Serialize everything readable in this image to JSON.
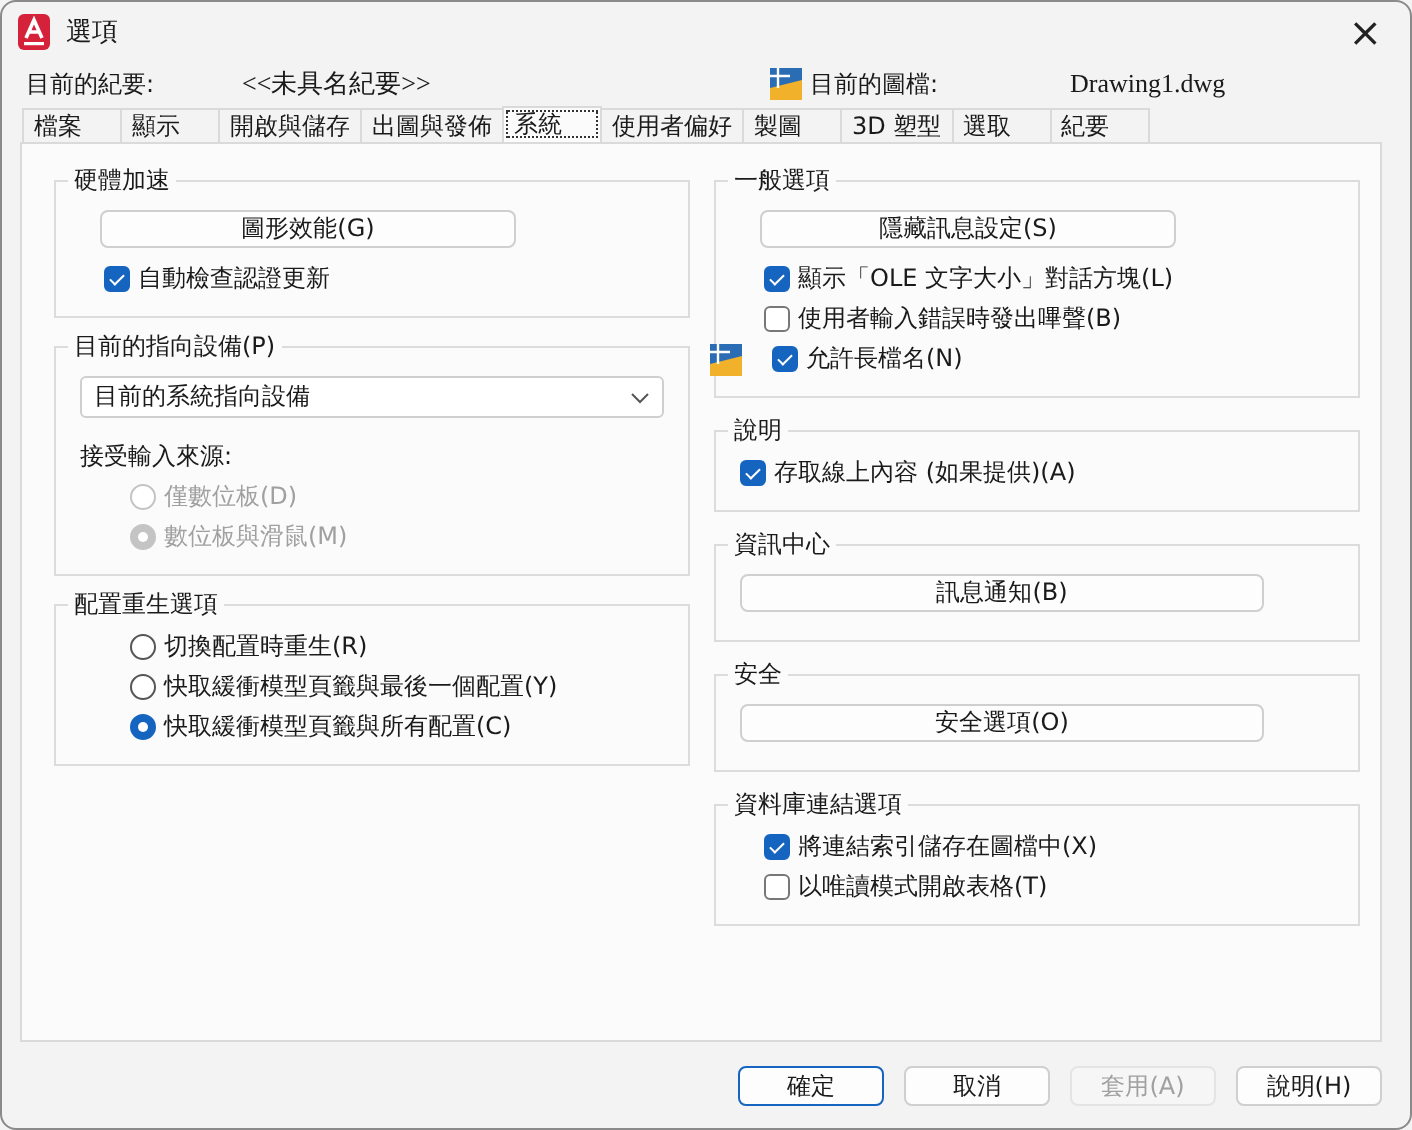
{
  "window": {
    "title": "選項",
    "close": "×"
  },
  "info": {
    "profile_label": "目前的紀要:",
    "profile_value": "<<未具名紀要>>",
    "drawing_label": "目前的圖檔:",
    "drawing_value": "Drawing1.dwg"
  },
  "tabs": [
    {
      "label": "檔案",
      "selected": false
    },
    {
      "label": "顯示",
      "selected": false
    },
    {
      "label": "開啟與儲存",
      "selected": false
    },
    {
      "label": "出圖與發佈",
      "selected": false
    },
    {
      "label": "系統",
      "selected": true
    },
    {
      "label": "使用者偏好",
      "selected": false
    },
    {
      "label": "製圖",
      "selected": false
    },
    {
      "label": "3D 塑型",
      "selected": false
    },
    {
      "label": "選取",
      "selected": false
    },
    {
      "label": "紀要",
      "selected": false
    }
  ],
  "left_groups": [
    {
      "title": "硬體加速",
      "items": [
        {
          "kind": "button",
          "label": "圖形效能(G)"
        },
        {
          "kind": "checkbox",
          "label": "自動檢查認證更新",
          "checked": true
        }
      ]
    },
    {
      "title": "目前的指向設備(P)",
      "items": [
        {
          "kind": "dropdown",
          "value": "目前的系統指向設備"
        },
        {
          "kind": "label",
          "label": "接受輸入來源:"
        },
        {
          "kind": "radio",
          "label": "僅數位板(D)",
          "selected": false,
          "disabled": true
        },
        {
          "kind": "radio",
          "label": "數位板與滑鼠(M)",
          "selected": true,
          "disabled": true
        }
      ]
    },
    {
      "title": "配置重生選項",
      "items": [
        {
          "kind": "radio",
          "label": "切換配置時重生(R)",
          "selected": false,
          "disabled": false
        },
        {
          "kind": "radio",
          "label": "快取緩衝模型頁籤與最後一個配置(Y)",
          "selected": false,
          "disabled": false
        },
        {
          "kind": "radio",
          "label": "快取緩衝模型頁籤與所有配置(C)",
          "selected": true,
          "disabled": false
        }
      ]
    }
  ],
  "right_groups": [
    {
      "title": "一般選項",
      "items": [
        {
          "kind": "button",
          "label": "隱藏訊息設定(S)"
        },
        {
          "kind": "checkbox",
          "label": "顯示「OLE 文字大小」對話方塊(L)",
          "checked": true
        },
        {
          "kind": "checkbox",
          "label": "使用者輸入錯誤時發出嗶聲(B)",
          "checked": false
        },
        {
          "kind": "checkbox",
          "label": "允許長檔名(N)",
          "checked": true,
          "icon": true
        }
      ]
    },
    {
      "title": "說明",
      "items": [
        {
          "kind": "checkbox",
          "label": "存取線上內容 (如果提供)(A)",
          "checked": true
        }
      ]
    },
    {
      "title": "資訊中心",
      "items": [
        {
          "kind": "button",
          "label": "訊息通知(B)"
        }
      ]
    },
    {
      "title": "安全",
      "items": [
        {
          "kind": "button",
          "label": "安全選項(O)"
        }
      ]
    },
    {
      "title": "資料庫連結選項",
      "items": [
        {
          "kind": "checkbox",
          "label": "將連結索引儲存在圖檔中(X)",
          "checked": true
        },
        {
          "kind": "checkbox",
          "label": "以唯讀模式開啟表格(T)",
          "checked": false
        }
      ]
    }
  ],
  "buttons": [
    {
      "label": "確定",
      "default": true,
      "disabled": false
    },
    {
      "label": "取消",
      "default": false,
      "disabled": false
    },
    {
      "label": "套用(A)",
      "default": false,
      "disabled": true
    },
    {
      "label": "說明(H)",
      "default": false,
      "disabled": false
    }
  ]
}
